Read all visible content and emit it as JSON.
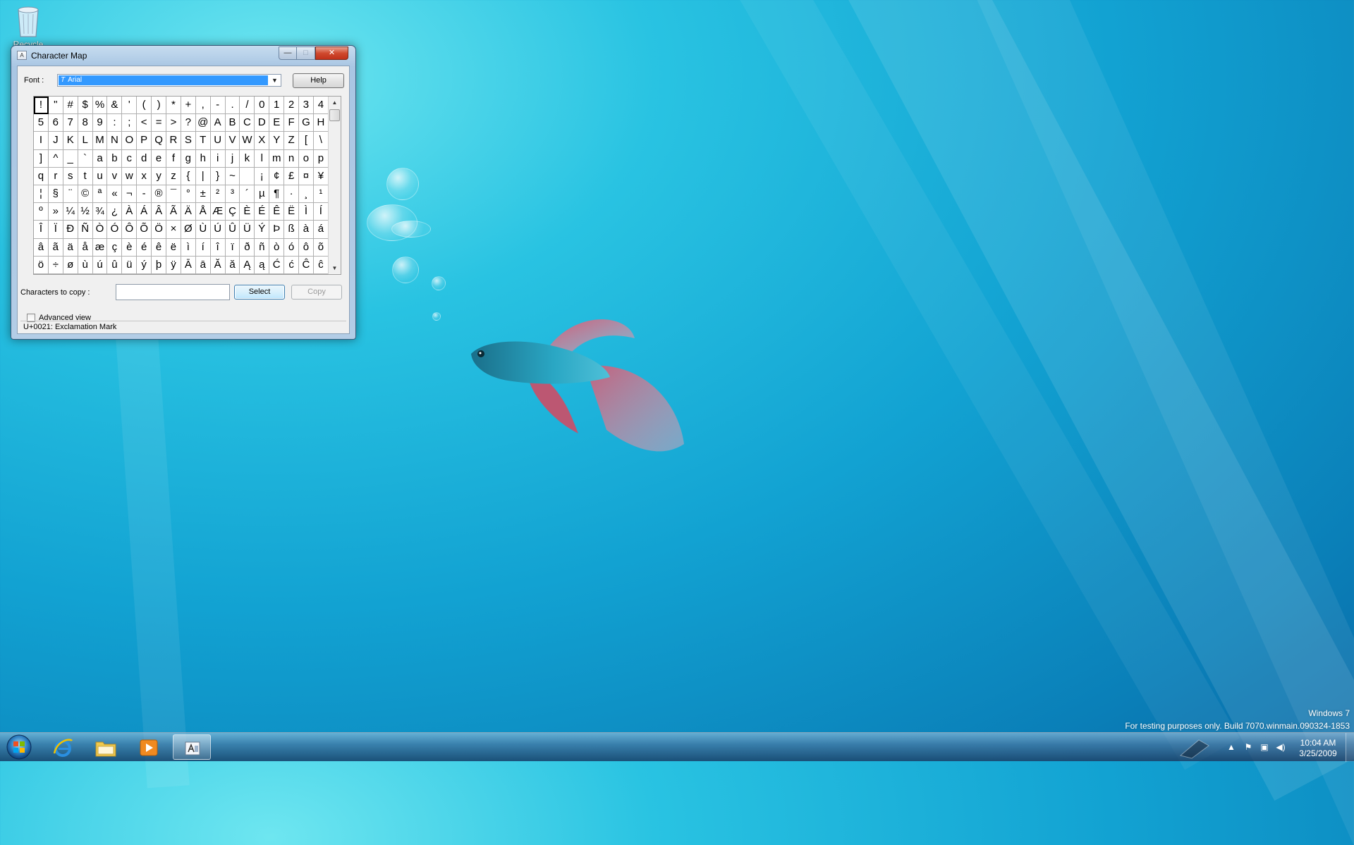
{
  "desktop": {
    "recycle_bin_label": "Recycle Bin",
    "watermark_line1": "Windows 7",
    "watermark_line2": "For testing purposes only. Build 7070.winmain.090324-1853"
  },
  "window": {
    "title": "Character Map",
    "controls": {
      "minimize": "—",
      "maximize": "□",
      "close": "✕"
    },
    "font_label": "Font :",
    "font_value": "Arial",
    "help_label": "Help",
    "characters": [
      "!",
      "\"",
      "#",
      "$",
      "%",
      "&",
      "'",
      "(",
      ")",
      "*",
      "+",
      ",",
      "-",
      ".",
      "/",
      "0",
      "1",
      "2",
      "3",
      "4",
      "5",
      "6",
      "7",
      "8",
      "9",
      ":",
      ";",
      "<",
      "=",
      ">",
      "?",
      "@",
      "A",
      "B",
      "C",
      "D",
      "E",
      "F",
      "G",
      "H",
      "I",
      "J",
      "K",
      "L",
      "M",
      "N",
      "O",
      "P",
      "Q",
      "R",
      "S",
      "T",
      "U",
      "V",
      "W",
      "X",
      "Y",
      "Z",
      "[",
      "\\",
      "]",
      "^",
      "_",
      "`",
      "a",
      "b",
      "c",
      "d",
      "e",
      "f",
      "g",
      "h",
      "i",
      "j",
      "k",
      "l",
      "m",
      "n",
      "o",
      "p",
      "q",
      "r",
      "s",
      "t",
      "u",
      "v",
      "w",
      "x",
      "y",
      "z",
      "{",
      "|",
      "}",
      "~",
      " ",
      "¡",
      "¢",
      "£",
      "¤",
      "¥",
      "¦",
      "§",
      "¨",
      "©",
      "ª",
      "«",
      "¬",
      "-",
      "®",
      "¯",
      "°",
      "±",
      "²",
      "³",
      "´",
      "µ",
      "¶",
      "·",
      "¸",
      "¹",
      "º",
      "»",
      "¼",
      "½",
      "¾",
      "¿",
      "À",
      "Á",
      "Â",
      "Ã",
      "Ä",
      "Å",
      "Æ",
      "Ç",
      "È",
      "É",
      "Ê",
      "Ë",
      "Ì",
      "Í",
      "Î",
      "Ï",
      "Ð",
      "Ñ",
      "Ò",
      "Ó",
      "Ô",
      "Õ",
      "Ö",
      "×",
      "Ø",
      "Ù",
      "Ú",
      "Û",
      "Ü",
      "Ý",
      "Þ",
      "ß",
      "à",
      "á",
      "â",
      "ã",
      "ä",
      "å",
      "æ",
      "ç",
      "è",
      "é",
      "ê",
      "ë",
      "ì",
      "í",
      "î",
      "ï",
      "ð",
      "ñ",
      "ò",
      "ó",
      "ô",
      "õ",
      "ö",
      "÷",
      "ø",
      "ù",
      "ú",
      "û",
      "ü",
      "ý",
      "þ",
      "ÿ",
      "Ā",
      "ā",
      "Ă",
      "ă",
      "Ą",
      "ą",
      "Ć",
      "ć",
      "Ĉ",
      "ĉ"
    ],
    "selected_index": 0,
    "chars_to_copy_label": "Characters to copy :",
    "chars_to_copy_value": "",
    "select_label": "Select",
    "copy_label": "Copy",
    "advanced_view_label": "Advanced view",
    "advanced_view_checked": false,
    "status_text": "U+0021: Exclamation Mark"
  },
  "taskbar": {
    "items": [
      "start-button",
      "internet-explorer",
      "windows-explorer",
      "media-player",
      "character-map"
    ],
    "active_item": "character-map",
    "clock_time": "10:04 AM",
    "clock_date": "3/25/2009"
  }
}
